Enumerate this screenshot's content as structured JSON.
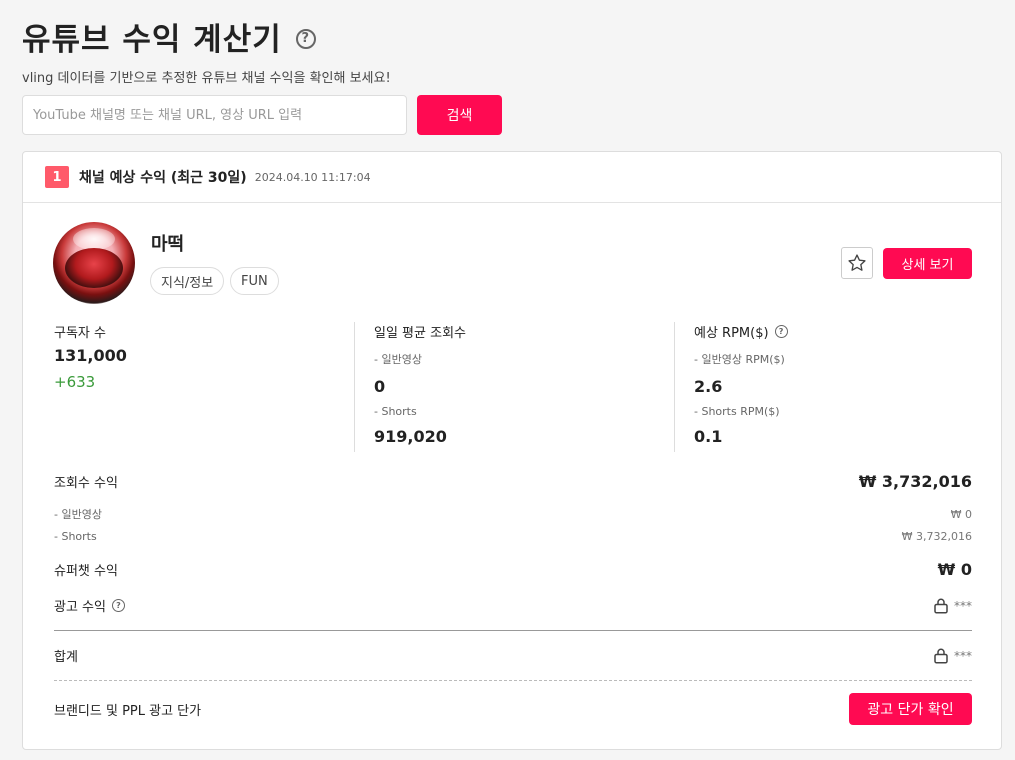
{
  "page": {
    "title": "유튜브 수익 계산기",
    "subtitle": "vling 데이터를 기반으로 추정한 유튜브 채널 수익을 확인해 보세요!",
    "help_glyph": "?"
  },
  "search": {
    "placeholder": "YouTube 채널명 또는 채널 URL, 영상 URL 입력",
    "value": "",
    "button_label": "검색"
  },
  "result_card": {
    "rank": "1",
    "title": "채널 예상 수익 (최근 30일)",
    "timestamp": "2024.04.10 11:17:04",
    "channel": {
      "name": "마떡",
      "tags": [
        "지식/정보",
        "FUN"
      ],
      "detail_button_label": "상세 보기",
      "favorite_icon": "star-outline-icon"
    },
    "stats": {
      "subscribers": {
        "label": "구독자 수",
        "value": "131,000",
        "delta": "+633"
      },
      "daily_views": {
        "label": "일일 평균 조회수",
        "normal_label": "- 일반영상",
        "normal_value": "0",
        "shorts_label": "- Shorts",
        "shorts_value": "919,020"
      },
      "rpm": {
        "label": "예상 RPM($)",
        "normal_label": "- 일반영상 RPM($)",
        "normal_value": "2.6",
        "shorts_label": "- Shorts RPM($)",
        "shorts_value": "0.1"
      }
    },
    "revenue": {
      "view_label": "조회수 수익",
      "view_value": "₩ 3,732,016",
      "normal_label": "- 일반영상",
      "normal_value": "₩ 0",
      "shorts_label": "- Shorts",
      "shorts_value": "₩ 3,732,016",
      "superchat_label": "슈퍼챗 수익",
      "superchat_value": "₩ 0",
      "ad_label": "광고 수익",
      "ad_value": "***",
      "total_label": "합계",
      "total_value": "***",
      "ppl_label": "브랜디드 및 PPL 광고 단가",
      "ppl_button_label": "광고 단가 확인"
    }
  },
  "colors": {
    "accent": "#ff0a52",
    "rank_badge": "#ff5a6a",
    "positive": "#3a9a3a"
  }
}
